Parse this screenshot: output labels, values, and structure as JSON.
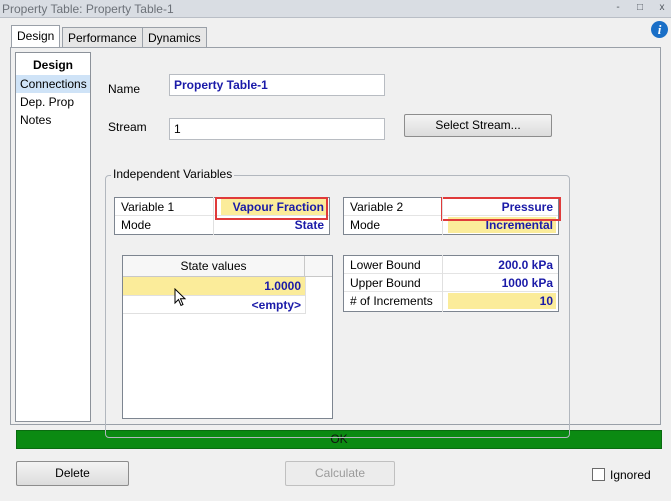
{
  "window": {
    "title": "Property Table: Property Table-1",
    "controls": [
      "-",
      "□",
      "x"
    ]
  },
  "tabs": [
    {
      "label": "Design",
      "active": true
    },
    {
      "label": "Performance",
      "active": false
    },
    {
      "label": "Dynamics",
      "active": false
    }
  ],
  "info_icon": "i",
  "sidebar": {
    "header": "Design",
    "items": [
      {
        "label": "Connections",
        "selected": true
      },
      {
        "label": "Dep. Prop",
        "selected": false
      },
      {
        "label": "Notes",
        "selected": false
      }
    ]
  },
  "form": {
    "name_label": "Name",
    "name_value": "Property Table-1",
    "stream_label": "Stream",
    "stream_value": "1",
    "select_stream_button": "Select Stream..."
  },
  "independent_variables": {
    "group_title": "Independent Variables",
    "var1": {
      "variable_label": "Variable 1",
      "variable_value": "Vapour Fraction",
      "mode_label": "Mode",
      "mode_value": "State"
    },
    "var2": {
      "variable_label": "Variable 2",
      "variable_value": "Pressure",
      "mode_label": "Mode",
      "mode_value": "Incremental"
    },
    "state_values": {
      "header": "State values",
      "rows": [
        "1.0000",
        "<empty>"
      ]
    },
    "bounds": {
      "lower_label": "Lower Bound",
      "lower_value": "200.0 kPa",
      "upper_label": "Upper Bound",
      "upper_value": "1000 kPa",
      "increments_label": "# of Increments",
      "increments_value": "10"
    }
  },
  "status": {
    "text": "OK",
    "color": "#0b8a12"
  },
  "footer": {
    "delete_button": "Delete",
    "calculate_button": "Calculate",
    "ignored_label": "Ignored",
    "ignored_checked": false
  },
  "colors": {
    "highlight_frame": "#e03a3a",
    "value_text": "#1a1aa8",
    "yellow_cell": "#fbec9a",
    "selected_nav": "#cfe3f7"
  }
}
